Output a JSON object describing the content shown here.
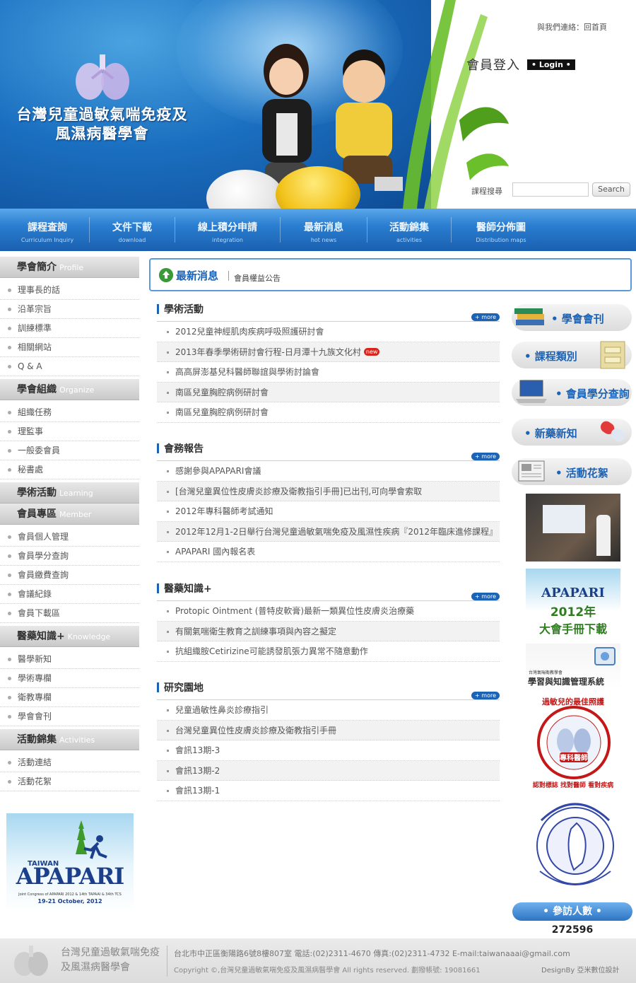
{
  "header": {
    "site_title_line1": "台灣兒童過敏氣喘免疫及",
    "site_title_line2": "風濕病醫學會",
    "top_link_contact": "與我們連絡",
    "top_link_sep": "：",
    "top_link_home": "回首頁",
    "login_label": "會員登入",
    "login_badge": "• Login •",
    "course_label": "課程搜尋",
    "course_placeholder": "",
    "search_button": "Search"
  },
  "nav": [
    {
      "zh": "課程查詢",
      "en": "Curriculum Inquiry"
    },
    {
      "zh": "文件下載",
      "en": "download"
    },
    {
      "zh": "線上積分申請",
      "en": "integration"
    },
    {
      "zh": "最新消息",
      "en": "hot news"
    },
    {
      "zh": "活動錦集",
      "en": "activities"
    },
    {
      "zh": "醫師分佈圖",
      "en": "Distribution maps"
    }
  ],
  "sidebar": {
    "sections": [
      {
        "zh": "學會簡介",
        "en": "Profile",
        "items": [
          "理事長的話",
          "沿革宗旨",
          "訓練標準",
          "相關網站",
          "Q & A"
        ]
      },
      {
        "zh": "學會組織",
        "en": "Organize",
        "items": [
          "組織任務",
          "理監事",
          "一般委會員",
          "秘書處"
        ]
      },
      {
        "zh": "學術活動",
        "en": "Learning",
        "items": []
      },
      {
        "zh": "會員專區",
        "en": "Member",
        "items": [
          "會員個人管理",
          "會員學分查詢",
          "會員繳費查詢",
          "會議紀錄",
          "會員下載區"
        ]
      },
      {
        "zh": "醫藥知識+",
        "en": "Knowledge",
        "items": [
          "醫學新知",
          "學術專欄",
          "衛教專欄",
          "學會會刊"
        ]
      },
      {
        "zh": "活動錦集",
        "en": "Activities",
        "items": [
          "活動連結",
          "活動花絮"
        ]
      }
    ],
    "apapari": {
      "taiwan": "TAIWAN",
      "brand": "APAPARI",
      "conference": "Joint Congress of APAPARI 2012 & 14th TAPAAI & 34th TCS",
      "date": "19-21 October, 2012"
    }
  },
  "news_bar": {
    "title": "最新消息",
    "subtitle": "會員權益公告"
  },
  "blocks": [
    {
      "title": "學術活動",
      "more": "+ more",
      "rows": [
        {
          "text": "2012兒童神經肌肉疾病呼吸照護研討會",
          "new": false
        },
        {
          "text": "2013年春季學術研討會行程-日月潭十九族文化村",
          "new": true
        },
        {
          "text": "高高屏澎基兒科醫師聯誼與學術討論會",
          "new": false
        },
        {
          "text": "南區兒童胸腔病例研討會",
          "new": false
        },
        {
          "text": "南區兒童胸腔病例研討會",
          "new": false
        }
      ]
    },
    {
      "title": "會務報告",
      "more": "+ more",
      "rows": [
        {
          "text": "感謝參與APAPARI會議",
          "new": false
        },
        {
          "text": "[台灣兒童異位性皮膚炎診療及衛教指引手冊]已出刊,可向學會索取",
          "new": false
        },
        {
          "text": "2012年專科醫師考試通知",
          "new": false
        },
        {
          "text": "2012年12月1-2日舉行台灣兒童過敏氣喘免疫及風濕性疾病『2012年臨床進修課程』",
          "new": false
        },
        {
          "text": "APAPARI 國內報名表",
          "new": false
        }
      ]
    },
    {
      "title": "醫藥知識+",
      "more": "+ more",
      "rows": [
        {
          "text": "Protopic Ointment (普特皮軟膏)最新一類異位性皮膚炎治療藥",
          "new": false
        },
        {
          "text": "有關氣喘衛生教育之訓練事項與內容之擬定",
          "new": false
        },
        {
          "text": "抗組織胺Cetirizine可能誘發肌張力異常不隨意動作",
          "new": false
        }
      ]
    },
    {
      "title": "研究園地",
      "more": "+ more",
      "rows": [
        {
          "text": "兒童過敏性鼻炎診療指引",
          "new": false
        },
        {
          "text": "台灣兒童異位性皮膚炎診療及衛教指引手冊",
          "new": false
        },
        {
          "text": "會訊13期-3",
          "new": false
        },
        {
          "text": "會訊13期-2",
          "new": false
        },
        {
          "text": "會訊13期-1",
          "new": false
        }
      ]
    }
  ],
  "new_badge": "new",
  "right": {
    "buttons": [
      "• 學會會刊",
      "• 課程類別",
      "• 會員學分查詢",
      "• 新藥新知",
      "• 活動花絮"
    ],
    "apapari_side": {
      "brand": "APAPARI",
      "year": "2012年",
      "download": "大會手冊下載"
    },
    "lms_small": "台灣氣喘衛教學會",
    "lms_title": "學習與知識管理系統",
    "badge_top": "過敏兒的最佳照護",
    "badge_center": "專科醫師",
    "badge_bottom": "認對標誌 找對醫師 看對疾病",
    "counter_label": "• 參訪人數 •",
    "counter_value": "272596"
  },
  "footer": {
    "name_line1": "台灣兒童過敏氣喘免疫",
    "name_line2": "及風濕病醫學會",
    "address": "台北市中正區衡陽路6號8樓807室 電話:(02)2311-4670 傳真:(02)2311-4732 E-mail:taiwanaaai@gmail.com",
    "copyright": "Copyright ©,台灣兒童過敏氣喘免疫及風濕病醫學會 All rights reserved. 劃撥帳號: 19081661",
    "design": "DesignBy 亞米數位設計"
  }
}
